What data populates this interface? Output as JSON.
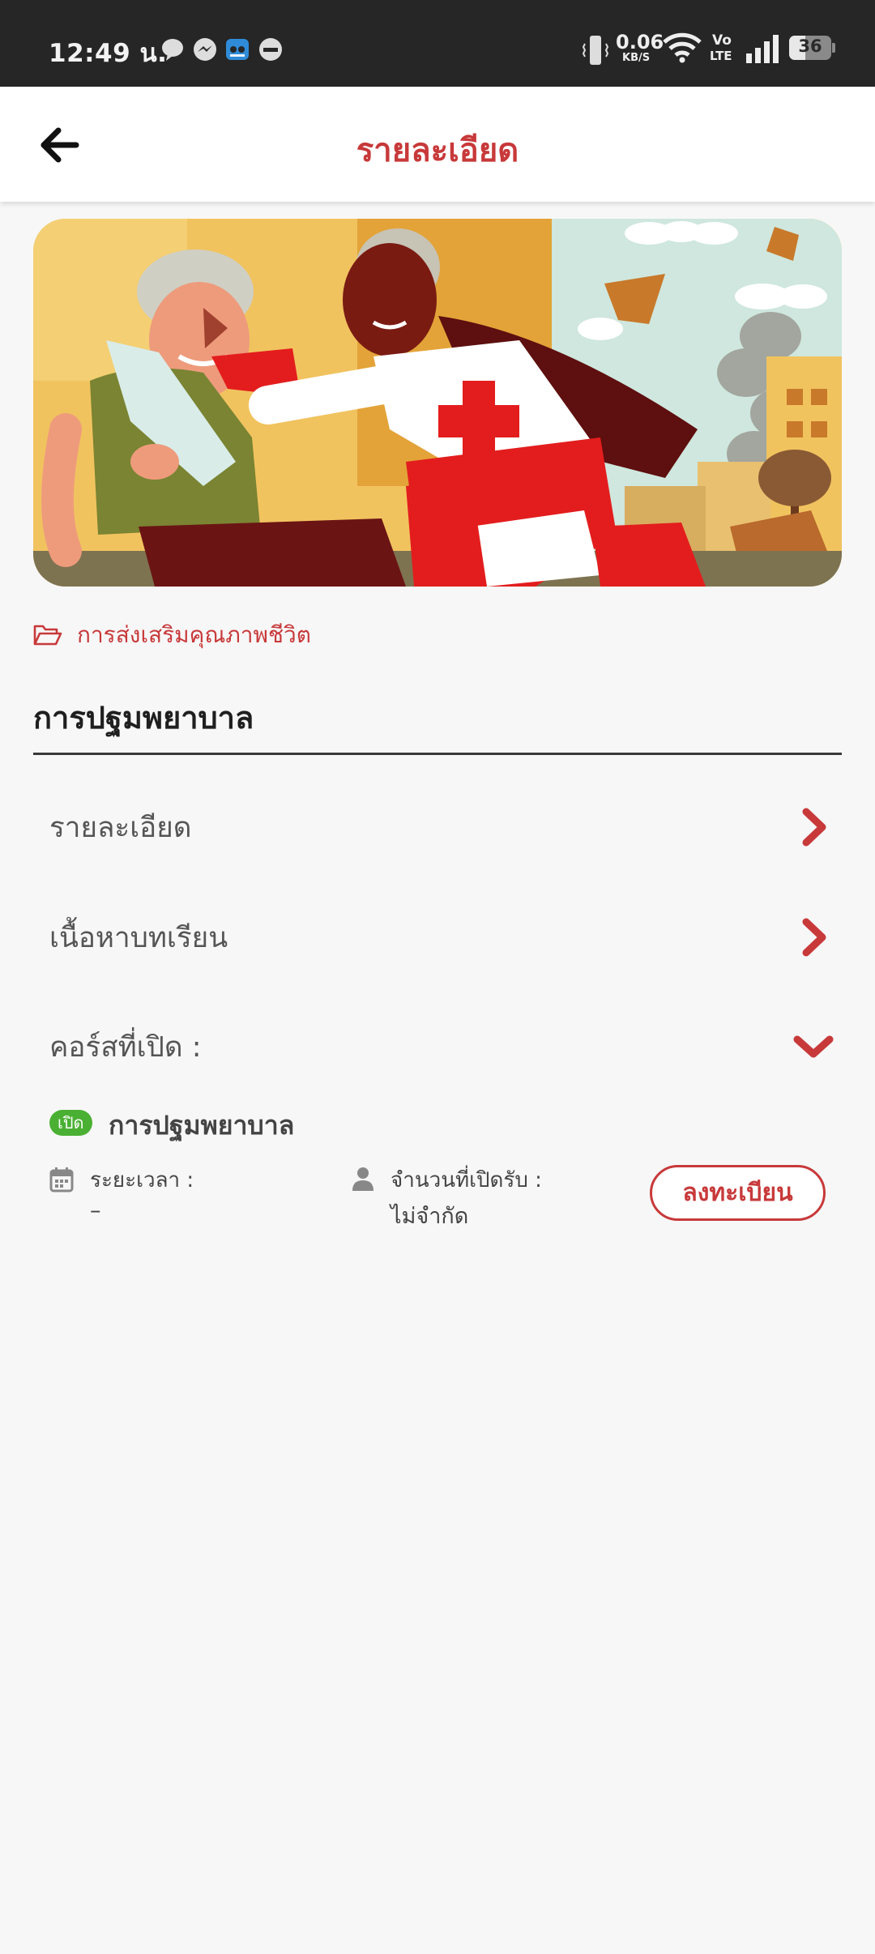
{
  "status_bar": {
    "time": "12:49 น.",
    "net_speed": "0.06",
    "net_unit": "KB/S",
    "volte_top": "Vo",
    "volte_bottom": "LTE",
    "battery": "36",
    "notification_icons": [
      "chat-bubble-icon",
      "messenger-icon",
      "game-icon",
      "minus-circle-icon"
    ]
  },
  "header": {
    "title": "รายละเอียด"
  },
  "hero_image": {
    "alt": "first-aid-illustration"
  },
  "course": {
    "category": "การส่งเสริมคุณภาพชีวิต",
    "title": "การปฐมพยาบาล"
  },
  "sections": [
    {
      "label": "รายละเอียด",
      "icon": "chevron-right-icon"
    },
    {
      "label": "เนื้อหาบทเรียน",
      "icon": "chevron-right-icon"
    },
    {
      "label": "คอร์สที่เปิด :",
      "icon": "chevron-down-icon"
    }
  ],
  "open_session": {
    "badge": "เปิด",
    "name": "การปฐมพยาบาล",
    "duration_label": "ระยะเวลา :",
    "duration_value": "–",
    "capacity_label": "จำนวนที่เปิดรับ :",
    "capacity_value": "ไม่จำกัด",
    "register_label": "ลงทะเบียน"
  },
  "colors": {
    "accent": "#c8393a",
    "open_badge": "#4ab033",
    "status_bar": "#262626"
  }
}
